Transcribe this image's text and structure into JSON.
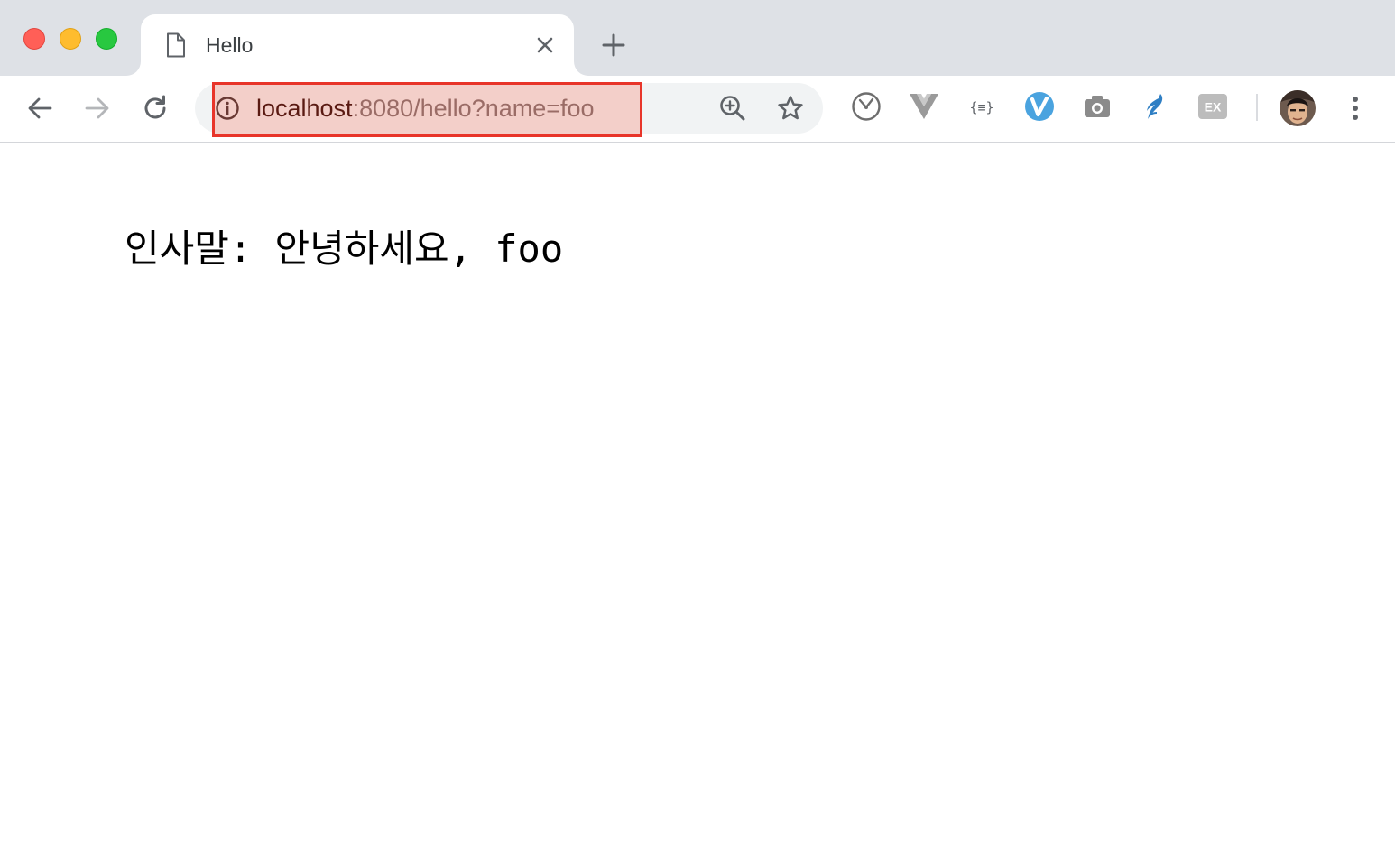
{
  "window": {
    "controls": [
      "close",
      "minimize",
      "maximize"
    ]
  },
  "tab": {
    "title": "Hello",
    "favicon": "document-icon"
  },
  "toolbar": {
    "back_icon": "arrow-left-icon",
    "forward_icon": "arrow-right-icon",
    "reload_icon": "reload-icon"
  },
  "omnibox": {
    "url_host": "localhost",
    "url_rest": ":8080/hello?name=foo",
    "highlight_color": "#e8352a"
  },
  "extensions": [
    "clock-extension-icon",
    "vue-devtools-icon",
    "json-viewer-icon",
    "vimium-icon",
    "screenshot-camera-icon",
    "bird-extension-icon",
    "ex-extension-icon"
  ],
  "content": {
    "greeting": "인사말: 안녕하세요, foo"
  }
}
